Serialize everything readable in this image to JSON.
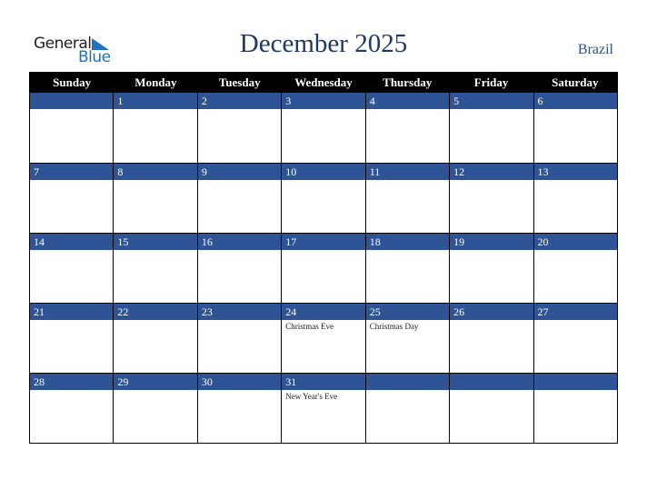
{
  "logo": {
    "line1": "General",
    "line2": "Blue"
  },
  "header": {
    "title": "December 2025",
    "country": "Brazil"
  },
  "weekdays": [
    "Sunday",
    "Monday",
    "Tuesday",
    "Wednesday",
    "Thursday",
    "Friday",
    "Saturday"
  ],
  "weeks": [
    [
      {
        "d": "",
        "h": ""
      },
      {
        "d": "1",
        "h": ""
      },
      {
        "d": "2",
        "h": ""
      },
      {
        "d": "3",
        "h": ""
      },
      {
        "d": "4",
        "h": ""
      },
      {
        "d": "5",
        "h": ""
      },
      {
        "d": "6",
        "h": ""
      }
    ],
    [
      {
        "d": "7",
        "h": ""
      },
      {
        "d": "8",
        "h": ""
      },
      {
        "d": "9",
        "h": ""
      },
      {
        "d": "10",
        "h": ""
      },
      {
        "d": "11",
        "h": ""
      },
      {
        "d": "12",
        "h": ""
      },
      {
        "d": "13",
        "h": ""
      }
    ],
    [
      {
        "d": "14",
        "h": ""
      },
      {
        "d": "15",
        "h": ""
      },
      {
        "d": "16",
        "h": ""
      },
      {
        "d": "17",
        "h": ""
      },
      {
        "d": "18",
        "h": ""
      },
      {
        "d": "19",
        "h": ""
      },
      {
        "d": "20",
        "h": ""
      }
    ],
    [
      {
        "d": "21",
        "h": ""
      },
      {
        "d": "22",
        "h": ""
      },
      {
        "d": "23",
        "h": ""
      },
      {
        "d": "24",
        "h": "Christmas Eve"
      },
      {
        "d": "25",
        "h": "Christmas Day"
      },
      {
        "d": "26",
        "h": ""
      },
      {
        "d": "27",
        "h": ""
      }
    ],
    [
      {
        "d": "28",
        "h": ""
      },
      {
        "d": "29",
        "h": ""
      },
      {
        "d": "30",
        "h": ""
      },
      {
        "d": "31",
        "h": "New Year's Eve"
      },
      {
        "d": "",
        "h": ""
      },
      {
        "d": "",
        "h": ""
      },
      {
        "d": "",
        "h": ""
      }
    ]
  ],
  "colors": {
    "band": "#2e5496",
    "title": "#1f3864",
    "logo_blue": "#1e73be"
  }
}
